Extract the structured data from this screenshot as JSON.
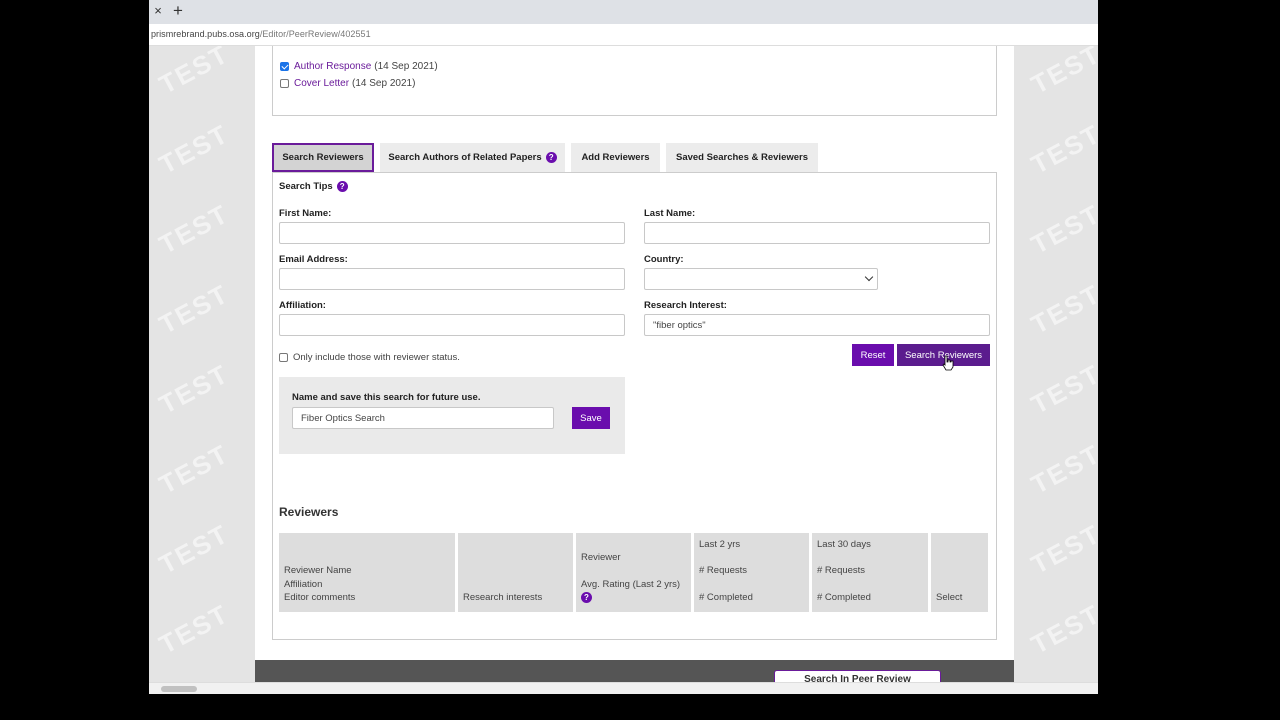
{
  "browser": {
    "tab_close": "×",
    "new_tab": "+",
    "url_host": "prismrebrand.pubs.osa.org",
    "url_path": "/Editor/PeerReview/402551"
  },
  "watermark": "TEST",
  "attachments": [
    {
      "label": "Author Response",
      "date": "(14 Sep 2021)",
      "checked": true
    },
    {
      "label": "Cover Letter",
      "date": "(14 Sep 2021)",
      "checked": false
    }
  ],
  "tabs": {
    "search_reviewers": "Search Reviewers",
    "search_authors": "Search Authors of Related Papers",
    "add_reviewers": "Add Reviewers",
    "saved_searches": "Saved Searches & Reviewers",
    "help_glyph": "?"
  },
  "form": {
    "search_tips": "Search Tips",
    "first_name_label": "First Name:",
    "first_name_value": "",
    "last_name_label": "Last Name:",
    "last_name_value": "",
    "email_label": "Email Address:",
    "email_value": "",
    "country_label": "Country:",
    "country_value": "",
    "affiliation_label": "Affiliation:",
    "affiliation_value": "",
    "interest_label": "Research Interest:",
    "interest_value": "\"fiber optics\"",
    "reviewer_status_label": "Only include those with reviewer status.",
    "reviewer_status_checked": false,
    "reset_label": "Reset",
    "search_label": "Search Reviewers"
  },
  "save_search": {
    "title": "Name and save this search for future use.",
    "value": "Fiber Optics Search",
    "button": "Save"
  },
  "reviewers": {
    "title": "Reviewers",
    "columns": {
      "name_1": "Reviewer Name",
      "name_2": "Affiliation",
      "name_3": "Editor comments",
      "interests": "Research interests",
      "rating_1": "Reviewer",
      "rating_2": "Avg. Rating (Last 2 yrs)",
      "last2_1": "Last 2 yrs",
      "last2_2": "# Requests",
      "last2_3": "# Completed",
      "last30_1": "Last 30 days",
      "last30_2": "# Requests",
      "last30_3": "# Completed",
      "select": "Select"
    }
  },
  "footer_button": "Search In Peer Review",
  "colors": {
    "accent": "#6a0dad",
    "link": "#6a1b9a"
  }
}
